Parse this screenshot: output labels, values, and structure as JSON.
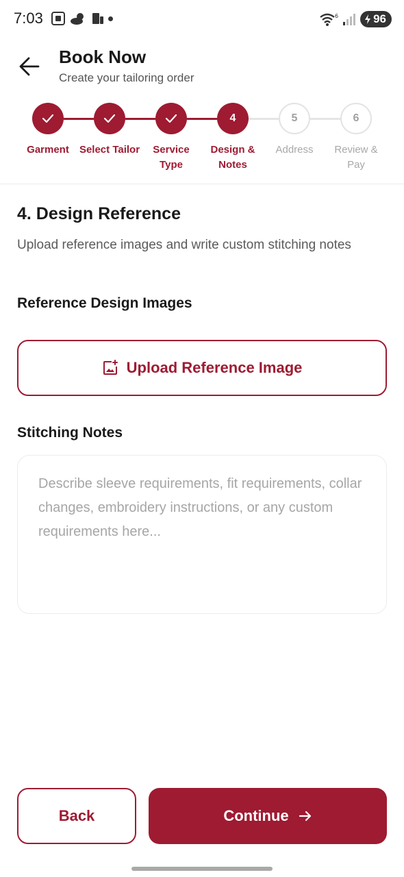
{
  "status_bar": {
    "time": "7:03",
    "battery": "96",
    "wifi_badge": "6"
  },
  "header": {
    "title": "Book Now",
    "subtitle": "Create your tailoring order"
  },
  "stepper": {
    "steps": [
      {
        "number": "1",
        "label_line1": "Garment",
        "label_line2": "",
        "state": "done"
      },
      {
        "number": "2",
        "label_line1": "Select Tailor",
        "label_line2": "",
        "state": "done"
      },
      {
        "number": "3",
        "label_line1": "Service",
        "label_line2": "Type",
        "state": "done"
      },
      {
        "number": "4",
        "label_line1": "Design &",
        "label_line2": "Notes",
        "state": "active"
      },
      {
        "number": "5",
        "label_line1": "Address",
        "label_line2": "",
        "state": "pending"
      },
      {
        "number": "6",
        "label_line1": "Review &",
        "label_line2": "Pay",
        "state": "pending"
      }
    ]
  },
  "section": {
    "title": "4. Design Reference",
    "description": "Upload reference images and write custom stitching notes",
    "images_label": "Reference Design Images",
    "upload_label": "Upload Reference Image",
    "notes_label": "Stitching Notes",
    "notes_placeholder": "Describe sleeve requirements, fit requirements, collar changes, embroidery instructions, or any custom requirements here...",
    "notes_value": ""
  },
  "footer": {
    "back_label": "Back",
    "continue_label": "Continue"
  },
  "colors": {
    "accent": "#9e1b32",
    "pending_border": "#e3e3e3",
    "pending_text": "#a8a8a8"
  },
  "icons": {
    "back": "arrow-left-icon",
    "upload": "add-photo-icon",
    "continue": "arrow-right-icon",
    "step_done": "check-icon"
  }
}
